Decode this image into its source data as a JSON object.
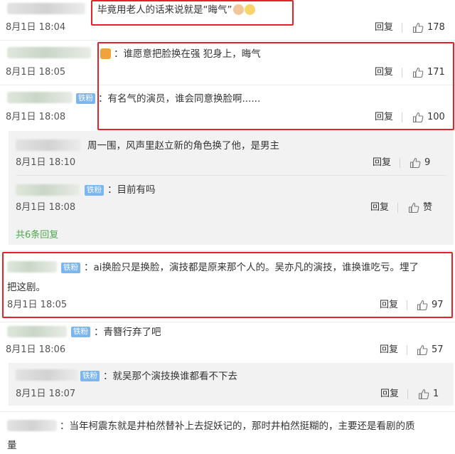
{
  "comments": [
    {
      "text": "毕竟用老人的话来说就是“晦气”",
      "time": "8月1日 18:04",
      "reply": "回复",
      "likes": "178"
    },
    {
      "text": "：谁愿意把脸换在强  犯身上，晦气",
      "time": "8月1日 18:05",
      "reply": "回复",
      "likes": "171"
    },
    {
      "badge": "铁粉",
      "text": "：有名气的演员，谁会同意换脸啊......",
      "time": "8月1日 18:08",
      "reply": "回复",
      "likes": "100"
    },
    {
      "text": "周一围，风声里赵立新的角色换了他，是男主",
      "time": "8月1日 18:10",
      "reply": "回复",
      "likes": "9"
    },
    {
      "badge": "铁粉",
      "text": "：目前有吗",
      "time": "8月1日 18:08",
      "reply": "回复",
      "likes": "赞"
    },
    {
      "more": "共6条回复"
    },
    {
      "badge": "铁粉",
      "text_line1": "：ai换脸只是换脸，演技都是原来那个人的。吴亦凡的演技，谁换谁吃亏。埋了",
      "text_line2": "把这剧。",
      "time": "8月1日 18:05",
      "reply": "回复",
      "likes": "97"
    },
    {
      "badge": "铁粉",
      "text": "：青簪行弃了吧",
      "time": "8月1日 18:06",
      "reply": "回复",
      "likes": "57"
    },
    {
      "badge": "铁粉",
      "text": "：就吴那个演技换谁都看不下去",
      "time": "8月1日 18:07",
      "reply": "回复",
      "likes": "1"
    },
    {
      "text_line1": "：当年柯震东就是井柏然替补上去捉妖记的，那时井柏然挺糊的，主要还是看剧的质",
      "text_line2": "量"
    }
  ],
  "colors": {
    "highlight": "#e5222c",
    "badge": "#7cb6ef",
    "more_link": "#51a64e"
  },
  "icons": {
    "like": "thumbs-up-icon",
    "emoji": "cat-face-emoji"
  }
}
